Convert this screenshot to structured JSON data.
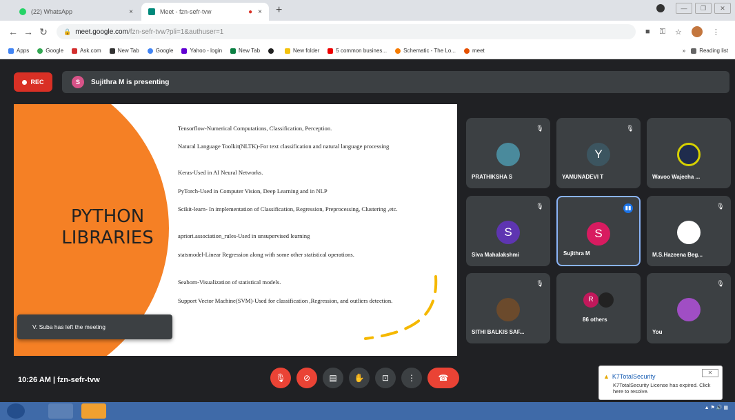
{
  "browser": {
    "tabs": [
      {
        "label": "(22) WhatsApp",
        "close": "×",
        "color": "#25d366"
      },
      {
        "label": "Meet - fzn-sefr-tvw",
        "close": "×",
        "color": "#00897b"
      }
    ],
    "new_tab": "+",
    "window_controls": [
      "—",
      "❐",
      "✕"
    ],
    "url_host": "meet.google.com",
    "url_path": "/fzn-sefr-tvw?pli=1&authuser=1",
    "bookmarks": [
      "Apps",
      "Google",
      "Ask.com",
      "New Tab",
      "Google",
      "Yahoo - login",
      "New Tab",
      "",
      "New folder",
      "5 common busines...",
      "Schematic - The Lo...",
      "meet"
    ],
    "reading_list": "Reading list"
  },
  "meet": {
    "rec_label": "REC",
    "presenter_initial": "S",
    "presenting_text": "Sujithra M is presenting",
    "time_code": "10:26 AM  |  fzn-sefr-tvw",
    "toast": "V. Suba has left the meeting"
  },
  "slide": {
    "title_line1": "PYTHON",
    "title_line2": "LIBRARIES",
    "lines": [
      "Tensorflow-Numerical Computations, Classification, Perception.",
      "Natural Language Toolkit(NLTK)-For text classification and natural language processing",
      "Keras-Used in AI Neural Networks.",
      "PyTorch-Used in Computer Vision, Deep Learning and in NLP",
      "Scikit-learn- In implementation of Classification, Regression, Preprocessing, Clustering ,etc.",
      "apriori.association_rules-Used in unsupervised learning",
      "statsmodel-Linear Regression along with some other statistical operations.",
      "Seaborn-Visualization of statistical models.",
      " Support Vector Machine(SVM)-Used for classification ,Regression, and outliers detection."
    ]
  },
  "participants": [
    {
      "name": "PRATHIKSHA S",
      "initial": "",
      "color": "#4a8a9c",
      "icon": "mic-off-icon"
    },
    {
      "name": "YAMUNADEVI T",
      "initial": "Y",
      "color": "#3c5560",
      "icon": "mic-off-icon"
    },
    {
      "name": "Wavoo Wajeeha ...",
      "initial": "",
      "color": "#1f2c4d",
      "icon": ""
    },
    {
      "name": "Siva Mahalakshmi",
      "initial": "S",
      "color": "#5e35b1",
      "icon": "mic-off-icon"
    },
    {
      "name": "Sujithra M",
      "initial": "S",
      "color": "#d81b60",
      "icon": "speaking-icon"
    },
    {
      "name": "M.S.Hazeena Beg...",
      "initial": "",
      "color": "#ffffff",
      "icon": "mic-off-icon"
    },
    {
      "name": "SITHI BALKIS SAF...",
      "initial": "",
      "color": "#6b4a2c",
      "icon": "mic-off-icon"
    },
    {
      "name": "86 others",
      "initial": "R",
      "color": "#c2185b",
      "icon": ""
    },
    {
      "name": "You",
      "initial": "",
      "color": "#a04ec4",
      "icon": "mic-off-icon"
    }
  ],
  "notification": {
    "title": "K7TotalSecurity",
    "message": "K7TotalSecurity License has expired. Click here to resolve."
  }
}
